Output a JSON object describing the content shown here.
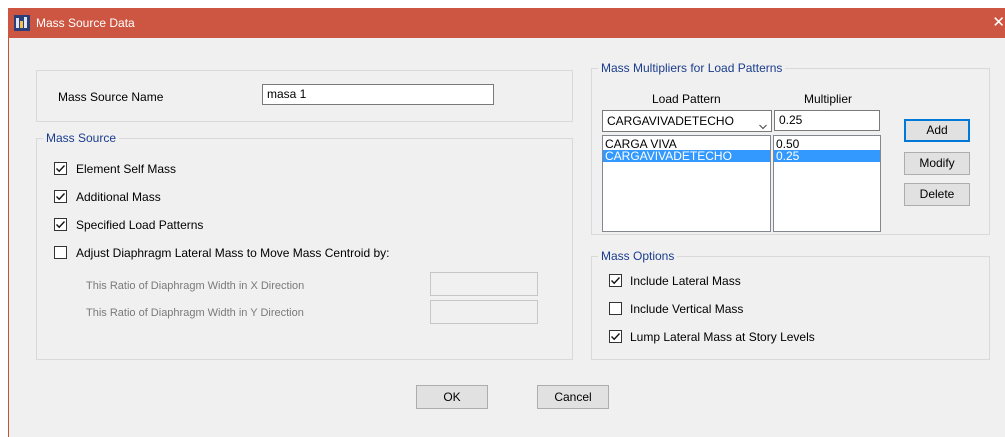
{
  "window": {
    "title": "Mass Source Data",
    "close_glyph": "✕"
  },
  "name_section": {
    "label": "Mass Source Name",
    "value": "masa 1"
  },
  "mass_source": {
    "legend": "Mass Source",
    "element_self_mass": {
      "label": "Element Self Mass",
      "checked": true
    },
    "additional_mass": {
      "label": "Additional Mass",
      "checked": true
    },
    "specified_load_patterns": {
      "label": "Specified Load Patterns",
      "checked": true
    },
    "adjust_diaphragm": {
      "label": "Adjust Diaphragm Lateral Mass to Move Mass Centroid by:",
      "checked": false
    },
    "ratio_x_label": "This Ratio of Diaphragm Width in X Direction",
    "ratio_y_label": "This Ratio of Diaphragm Width in Y Direction",
    "ratio_x_value": "",
    "ratio_y_value": ""
  },
  "multipliers": {
    "legend": "Mass Multipliers for Load Patterns",
    "col_pattern": "Load Pattern",
    "col_multiplier": "Multiplier",
    "selected_pattern": "CARGAVIVADETECHO",
    "multiplier_value": "0.25",
    "rows": [
      {
        "pattern": "CARGA VIVA",
        "multiplier": "0.50"
      },
      {
        "pattern": "CARGAVIVADETECHO",
        "multiplier": "0.25"
      }
    ],
    "add_label": "Add",
    "modify_label": "Modify",
    "delete_label": "Delete"
  },
  "mass_options": {
    "legend": "Mass Options",
    "include_lateral": {
      "label": "Include Lateral Mass",
      "checked": true
    },
    "include_vertical": {
      "label": "Include Vertical Mass",
      "checked": false
    },
    "lump_lateral": {
      "label": "Lump Lateral Mass at Story Levels",
      "checked": true
    }
  },
  "footer": {
    "ok_label": "OK",
    "cancel_label": "Cancel"
  },
  "colors": {
    "titlebar": "#cd5642",
    "legend_text": "#1a3c8c",
    "selection": "#3399ff"
  }
}
